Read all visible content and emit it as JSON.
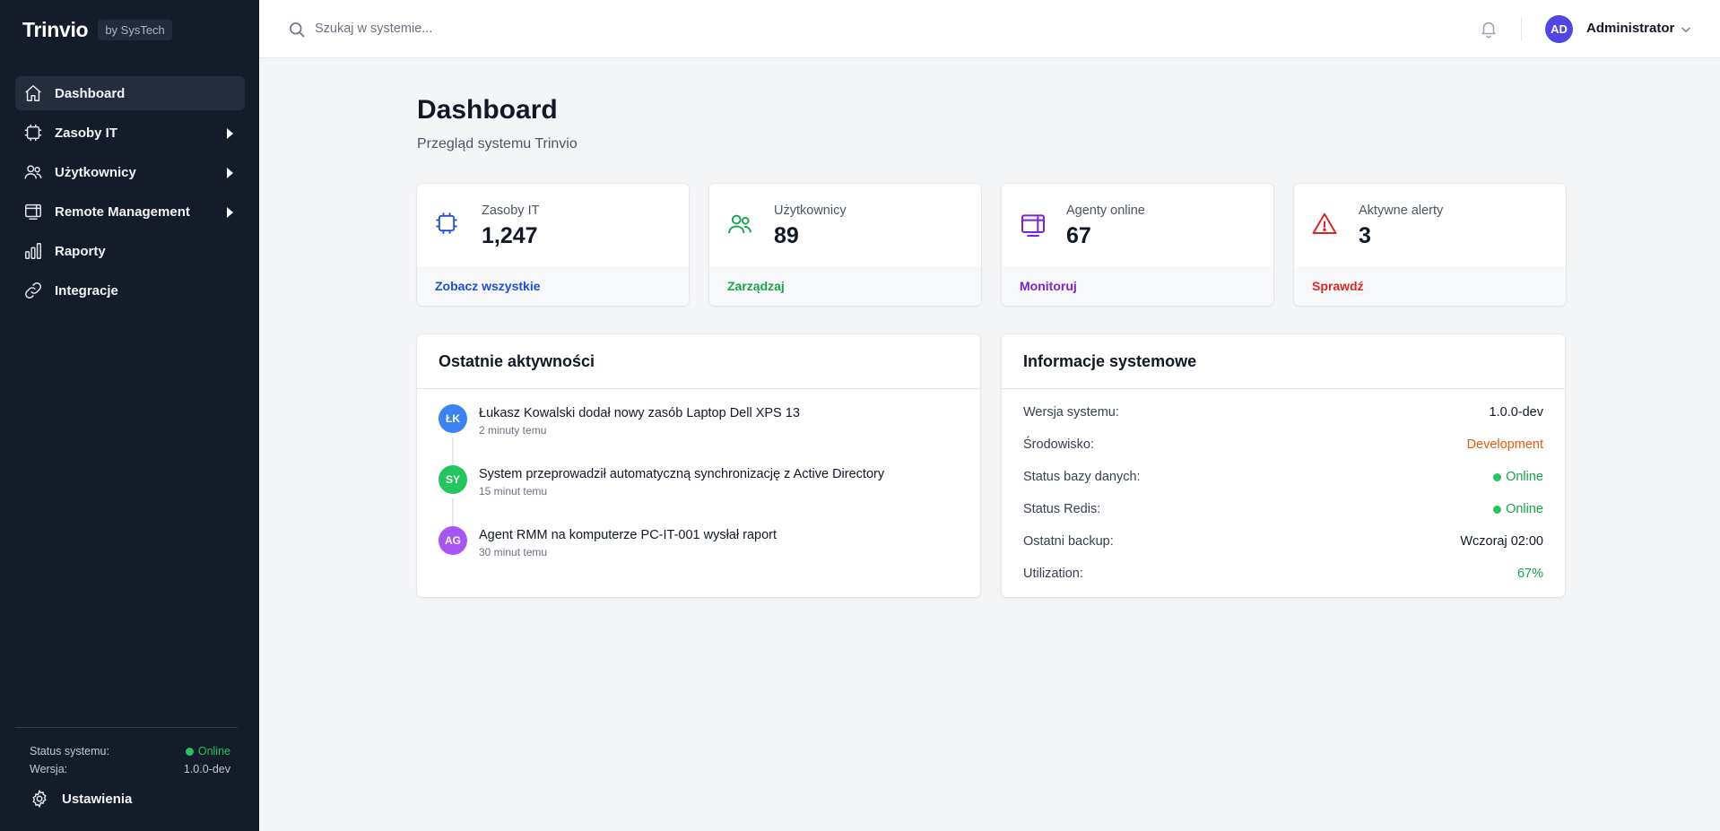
{
  "sidebar": {
    "brand": "Trinvio",
    "brand_badge": "by SysTech",
    "items": [
      {
        "label": "Dashboard",
        "icon": "home-icon",
        "active": true
      },
      {
        "label": "Zasoby IT",
        "icon": "chip-icon",
        "has_children": true
      },
      {
        "label": "Użytkownicy",
        "icon": "users-icon",
        "has_children": true
      },
      {
        "label": "Remote Management",
        "icon": "remote-icon",
        "has_children": true
      },
      {
        "label": "Raporty",
        "icon": "chart-icon"
      },
      {
        "label": "Integracje",
        "icon": "link-icon"
      }
    ],
    "status_label": "Status systemu:",
    "status_value": "Online",
    "version_label": "Wersja:",
    "version_value": "1.0.0-dev",
    "settings_label": "Ustawienia"
  },
  "topbar": {
    "search_placeholder": "Szukaj w systemie...",
    "user_initials": "AD",
    "user_name": "Administrator"
  },
  "page": {
    "title": "Dashboard",
    "subtitle": "Przegląd systemu Trinvio"
  },
  "stats": [
    {
      "label": "Zasoby IT",
      "value": "1,247",
      "link": "Zobacz wszystkie",
      "color": "#1d4ed8",
      "icon": "chip-icon"
    },
    {
      "label": "Użytkownicy",
      "value": "89",
      "link": "Zarządzaj",
      "color": "#16a34a",
      "icon": "users-icon"
    },
    {
      "label": "Agenty online",
      "value": "67",
      "link": "Monitoruj",
      "color": "#7e22ce",
      "icon": "remote-icon"
    },
    {
      "label": "Aktywne alerty",
      "value": "3",
      "link": "Sprawdź",
      "color": "#dc2626",
      "icon": "warning-icon"
    }
  ],
  "activity": {
    "title": "Ostatnie aktywności",
    "items": [
      {
        "initials": "ŁK",
        "color": "#3b82f6",
        "text": "Łukasz Kowalski dodał nowy zasób Laptop Dell XPS 13",
        "time": "2 minuty temu"
      },
      {
        "initials": "SY",
        "color": "#22c55e",
        "text": "System przeprowadził automatyczną synchronizację z Active Directory",
        "time": "15 minut temu"
      },
      {
        "initials": "AG",
        "color": "#a855f7",
        "text": "Agent RMM na komputerze PC-IT-001 wysłał raport",
        "time": "30 minut temu"
      }
    ]
  },
  "system_info": {
    "title": "Informacje systemowe",
    "rows": [
      {
        "label": "Wersja systemu:",
        "value": "1.0.0-dev",
        "color": "#111827"
      },
      {
        "label": "Środowisko:",
        "value": "Development",
        "color": "#ea580c"
      },
      {
        "label": "Status bazy danych:",
        "value": "Online",
        "color": "#16a34a",
        "dot": true
      },
      {
        "label": "Status Redis:",
        "value": "Online",
        "color": "#16a34a",
        "dot": true
      },
      {
        "label": "Ostatni backup:",
        "value": "Wczoraj 02:00",
        "color": "#111827"
      },
      {
        "label": "Utilization:",
        "value": "67%",
        "color": "#16a34a"
      }
    ]
  }
}
